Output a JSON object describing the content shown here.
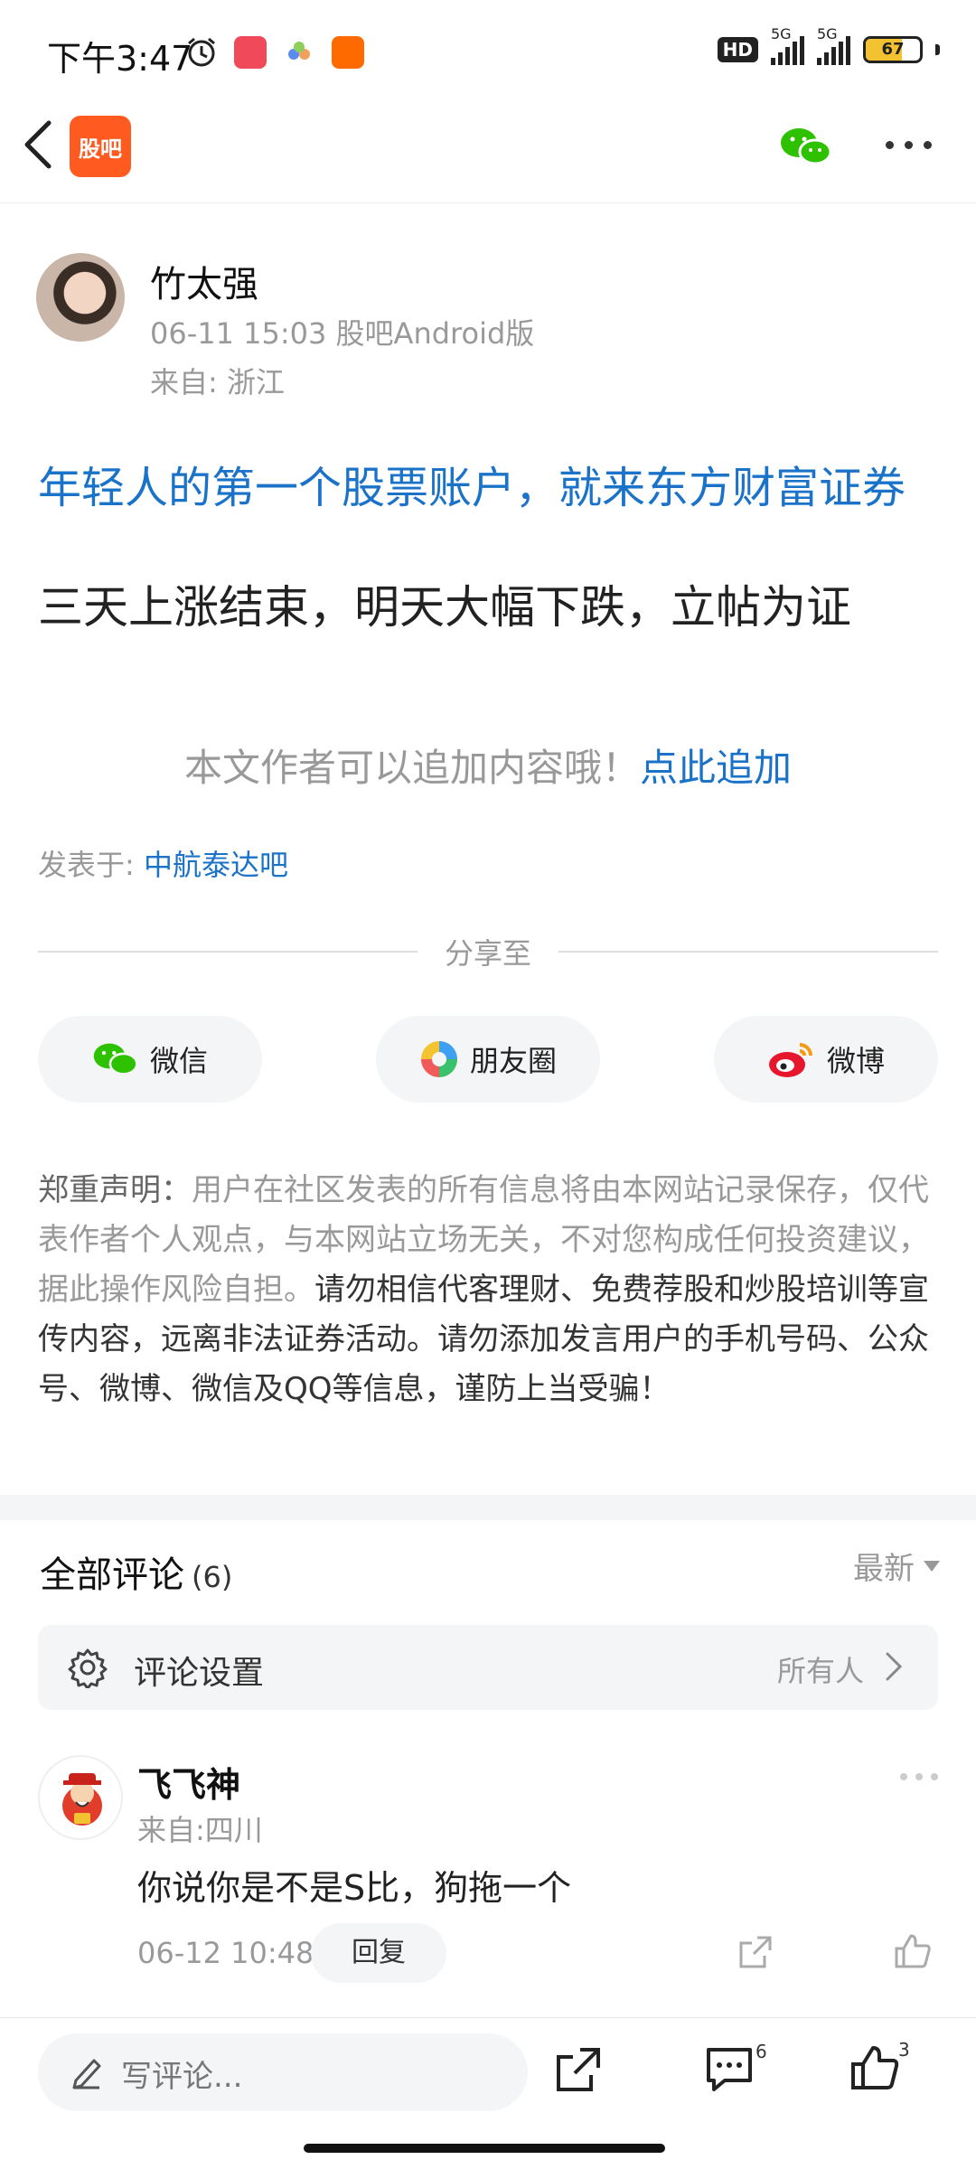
{
  "status_bar": {
    "time": "下午3:47",
    "hd": "HD",
    "net1": "5G",
    "net2": "5G",
    "battery": "67"
  },
  "nav": {
    "logo_text": "股吧",
    "wechat_icon": "wechat-icon",
    "more_icon": "more-icon"
  },
  "post": {
    "author": "竹太强",
    "meta": "06-11 15:03 股吧Android版",
    "location": "来自: 浙江",
    "ad_link": "年轻人的第一个股票账户，就来东方财富证券",
    "text": "三天上涨结束，明天大幅下跌，立帖为证",
    "append_hint": "本文作者可以追加内容哦！",
    "append_link": "点此追加",
    "posted_in_label": "发表于: ",
    "posted_in_bar": "中航泰达吧"
  },
  "share": {
    "title": "分享至",
    "wechat": "微信",
    "moments": "朋友圈",
    "weibo": "微博"
  },
  "disclaimer": {
    "lead": "郑重声明：",
    "body": "用户在社区发表的所有信息将由本网站记录保存，仅代表作者个人观点，与本网站立场无关，不对您构成任何投资建议，据此操作风险自担。",
    "strong": "请勿相信代客理财、免费荐股和炒股培训等宣传内容，远离非法证券活动。请勿添加发言用户的手机号码、公众号、微博、微信及QQ等信息，谨防上当受骗！"
  },
  "comments": {
    "title": "全部评论",
    "count": "(6)",
    "sort": "最新",
    "settings_label": "评论设置",
    "settings_value": "所有人",
    "items": [
      {
        "name": "飞飞神",
        "location": "来自:四川",
        "text": "你说你是不是S比，狗拖一个",
        "time": "06-12 10:48",
        "reply": "回复"
      }
    ]
  },
  "bottom_bar": {
    "placeholder": "写评论...",
    "comment_count": "6",
    "like_count": "3"
  },
  "colors": {
    "brand": "#ff5a1f",
    "link": "#1a73c9",
    "wechat": "#2dc100",
    "weibo": "#e6162d"
  }
}
